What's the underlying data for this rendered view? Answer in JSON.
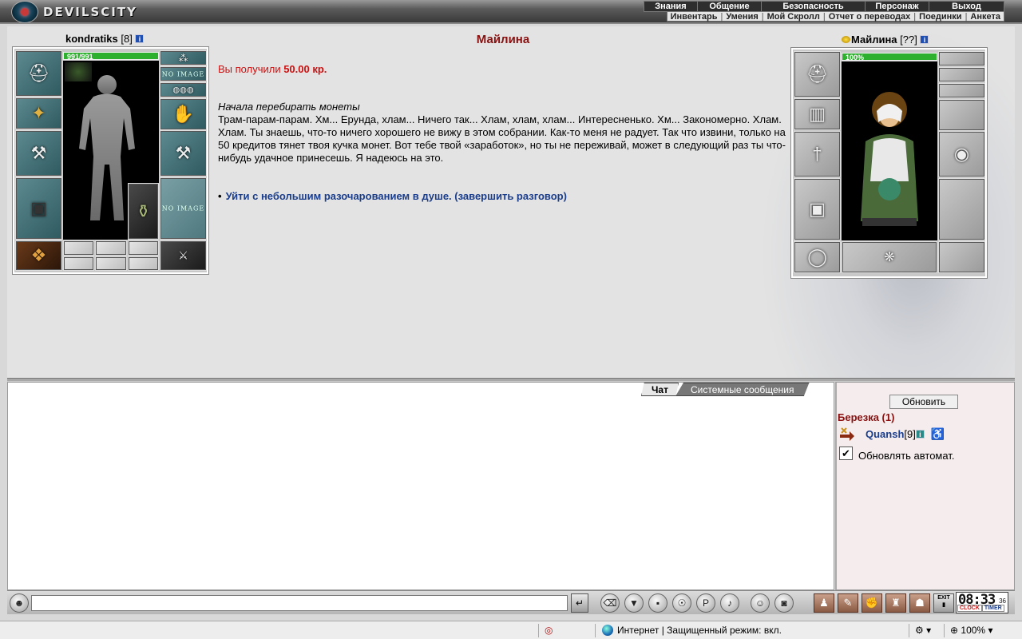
{
  "header": {
    "logo_text": "DEVILSCITY",
    "menu_main": [
      "Знания",
      "Общение",
      "Безопасность",
      "Персонаж",
      "Выход"
    ],
    "menu_sub": [
      "Инвентарь",
      "Умения",
      "Мой Скролл",
      "Отчет о переводах",
      "Поединки",
      "Анкета"
    ]
  },
  "player": {
    "name": "kondratiks",
    "level": "[8]",
    "hp": "991/991",
    "no_image_1": "NO IMAGE",
    "no_image_2": "NO IMAGE",
    "hp_fraction": 1.0
  },
  "npc": {
    "name": "Майлина",
    "level": "[??]",
    "hp": "100%",
    "hp_fraction": 1.0
  },
  "dialog": {
    "title": "Майлина",
    "received_prefix": "Вы получили ",
    "received_amount": "50.00 кр.",
    "intro": "Начала перебирать монеты",
    "text": "Трам-парам-парам. Хм... Ерунда, хлам... Ничего так... Хлам, хлам, хлам... Интересненько. Хм... Закономерно. Хлам. Хлам. Ты знаешь, что-то ничего хорошего не вижу в этом собрании. Как-то меня не радует. Так что извини, только на 50 кредитов тянет твоя кучка монет. Вот тебе твой «заработок», но ты не переживай, может в следующий раз ты что-нибудь удачное принесешь. Я надеюсь на это.",
    "answer": "Уйти с небольшим разочарованием в душе. (завершить разговор)"
  },
  "chat": {
    "tab_chat": "Чат",
    "tab_system": "Системные сообщения",
    "input_value": ""
  },
  "sidepanel": {
    "refresh": "Обновить",
    "room": "Березка (1)",
    "user_name": "Quansh",
    "user_level": "[9]",
    "auto_refresh": "Обновлять автомат.",
    "auto_checked": true
  },
  "toolbar": {
    "exit_label": "EXIT",
    "clock_time": "08:33",
    "clock_seconds": "36",
    "clock_label": "CLOCK",
    "timer_label": "TIMER"
  },
  "statusbar": {
    "zone": "Интернет | Защищенный режим: вкл.",
    "zoom": "100%"
  },
  "colors": {
    "dialog_title": "#8a1010",
    "link": "#1a3d8c",
    "money": "#cc1010",
    "hp_bar": "#2db02d"
  }
}
